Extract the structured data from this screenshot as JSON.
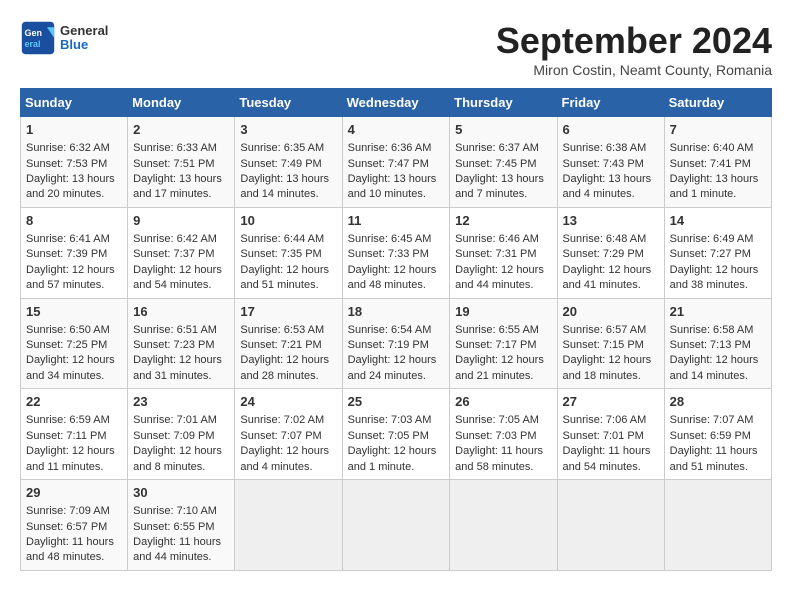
{
  "header": {
    "logo_line1": "General",
    "logo_line2": "Blue",
    "month": "September 2024",
    "location": "Miron Costin, Neamt County, Romania"
  },
  "weekdays": [
    "Sunday",
    "Monday",
    "Tuesday",
    "Wednesday",
    "Thursday",
    "Friday",
    "Saturday"
  ],
  "weeks": [
    [
      {
        "day": "1",
        "lines": [
          "Sunrise: 6:32 AM",
          "Sunset: 7:53 PM",
          "Daylight: 13 hours",
          "and 20 minutes."
        ]
      },
      {
        "day": "2",
        "lines": [
          "Sunrise: 6:33 AM",
          "Sunset: 7:51 PM",
          "Daylight: 13 hours",
          "and 17 minutes."
        ]
      },
      {
        "day": "3",
        "lines": [
          "Sunrise: 6:35 AM",
          "Sunset: 7:49 PM",
          "Daylight: 13 hours",
          "and 14 minutes."
        ]
      },
      {
        "day": "4",
        "lines": [
          "Sunrise: 6:36 AM",
          "Sunset: 7:47 PM",
          "Daylight: 13 hours",
          "and 10 minutes."
        ]
      },
      {
        "day": "5",
        "lines": [
          "Sunrise: 6:37 AM",
          "Sunset: 7:45 PM",
          "Daylight: 13 hours",
          "and 7 minutes."
        ]
      },
      {
        "day": "6",
        "lines": [
          "Sunrise: 6:38 AM",
          "Sunset: 7:43 PM",
          "Daylight: 13 hours",
          "and 4 minutes."
        ]
      },
      {
        "day": "7",
        "lines": [
          "Sunrise: 6:40 AM",
          "Sunset: 7:41 PM",
          "Daylight: 13 hours",
          "and 1 minute."
        ]
      }
    ],
    [
      {
        "day": "8",
        "lines": [
          "Sunrise: 6:41 AM",
          "Sunset: 7:39 PM",
          "Daylight: 12 hours",
          "and 57 minutes."
        ]
      },
      {
        "day": "9",
        "lines": [
          "Sunrise: 6:42 AM",
          "Sunset: 7:37 PM",
          "Daylight: 12 hours",
          "and 54 minutes."
        ]
      },
      {
        "day": "10",
        "lines": [
          "Sunrise: 6:44 AM",
          "Sunset: 7:35 PM",
          "Daylight: 12 hours",
          "and 51 minutes."
        ]
      },
      {
        "day": "11",
        "lines": [
          "Sunrise: 6:45 AM",
          "Sunset: 7:33 PM",
          "Daylight: 12 hours",
          "and 48 minutes."
        ]
      },
      {
        "day": "12",
        "lines": [
          "Sunrise: 6:46 AM",
          "Sunset: 7:31 PM",
          "Daylight: 12 hours",
          "and 44 minutes."
        ]
      },
      {
        "day": "13",
        "lines": [
          "Sunrise: 6:48 AM",
          "Sunset: 7:29 PM",
          "Daylight: 12 hours",
          "and 41 minutes."
        ]
      },
      {
        "day": "14",
        "lines": [
          "Sunrise: 6:49 AM",
          "Sunset: 7:27 PM",
          "Daylight: 12 hours",
          "and 38 minutes."
        ]
      }
    ],
    [
      {
        "day": "15",
        "lines": [
          "Sunrise: 6:50 AM",
          "Sunset: 7:25 PM",
          "Daylight: 12 hours",
          "and 34 minutes."
        ]
      },
      {
        "day": "16",
        "lines": [
          "Sunrise: 6:51 AM",
          "Sunset: 7:23 PM",
          "Daylight: 12 hours",
          "and 31 minutes."
        ]
      },
      {
        "day": "17",
        "lines": [
          "Sunrise: 6:53 AM",
          "Sunset: 7:21 PM",
          "Daylight: 12 hours",
          "and 28 minutes."
        ]
      },
      {
        "day": "18",
        "lines": [
          "Sunrise: 6:54 AM",
          "Sunset: 7:19 PM",
          "Daylight: 12 hours",
          "and 24 minutes."
        ]
      },
      {
        "day": "19",
        "lines": [
          "Sunrise: 6:55 AM",
          "Sunset: 7:17 PM",
          "Daylight: 12 hours",
          "and 21 minutes."
        ]
      },
      {
        "day": "20",
        "lines": [
          "Sunrise: 6:57 AM",
          "Sunset: 7:15 PM",
          "Daylight: 12 hours",
          "and 18 minutes."
        ]
      },
      {
        "day": "21",
        "lines": [
          "Sunrise: 6:58 AM",
          "Sunset: 7:13 PM",
          "Daylight: 12 hours",
          "and 14 minutes."
        ]
      }
    ],
    [
      {
        "day": "22",
        "lines": [
          "Sunrise: 6:59 AM",
          "Sunset: 7:11 PM",
          "Daylight: 12 hours",
          "and 11 minutes."
        ]
      },
      {
        "day": "23",
        "lines": [
          "Sunrise: 7:01 AM",
          "Sunset: 7:09 PM",
          "Daylight: 12 hours",
          "and 8 minutes."
        ]
      },
      {
        "day": "24",
        "lines": [
          "Sunrise: 7:02 AM",
          "Sunset: 7:07 PM",
          "Daylight: 12 hours",
          "and 4 minutes."
        ]
      },
      {
        "day": "25",
        "lines": [
          "Sunrise: 7:03 AM",
          "Sunset: 7:05 PM",
          "Daylight: 12 hours",
          "and 1 minute."
        ]
      },
      {
        "day": "26",
        "lines": [
          "Sunrise: 7:05 AM",
          "Sunset: 7:03 PM",
          "Daylight: 11 hours",
          "and 58 minutes."
        ]
      },
      {
        "day": "27",
        "lines": [
          "Sunrise: 7:06 AM",
          "Sunset: 7:01 PM",
          "Daylight: 11 hours",
          "and 54 minutes."
        ]
      },
      {
        "day": "28",
        "lines": [
          "Sunrise: 7:07 AM",
          "Sunset: 6:59 PM",
          "Daylight: 11 hours",
          "and 51 minutes."
        ]
      }
    ],
    [
      {
        "day": "29",
        "lines": [
          "Sunrise: 7:09 AM",
          "Sunset: 6:57 PM",
          "Daylight: 11 hours",
          "and 48 minutes."
        ]
      },
      {
        "day": "30",
        "lines": [
          "Sunrise: 7:10 AM",
          "Sunset: 6:55 PM",
          "Daylight: 11 hours",
          "and 44 minutes."
        ]
      },
      {
        "day": "",
        "lines": []
      },
      {
        "day": "",
        "lines": []
      },
      {
        "day": "",
        "lines": []
      },
      {
        "day": "",
        "lines": []
      },
      {
        "day": "",
        "lines": []
      }
    ]
  ]
}
